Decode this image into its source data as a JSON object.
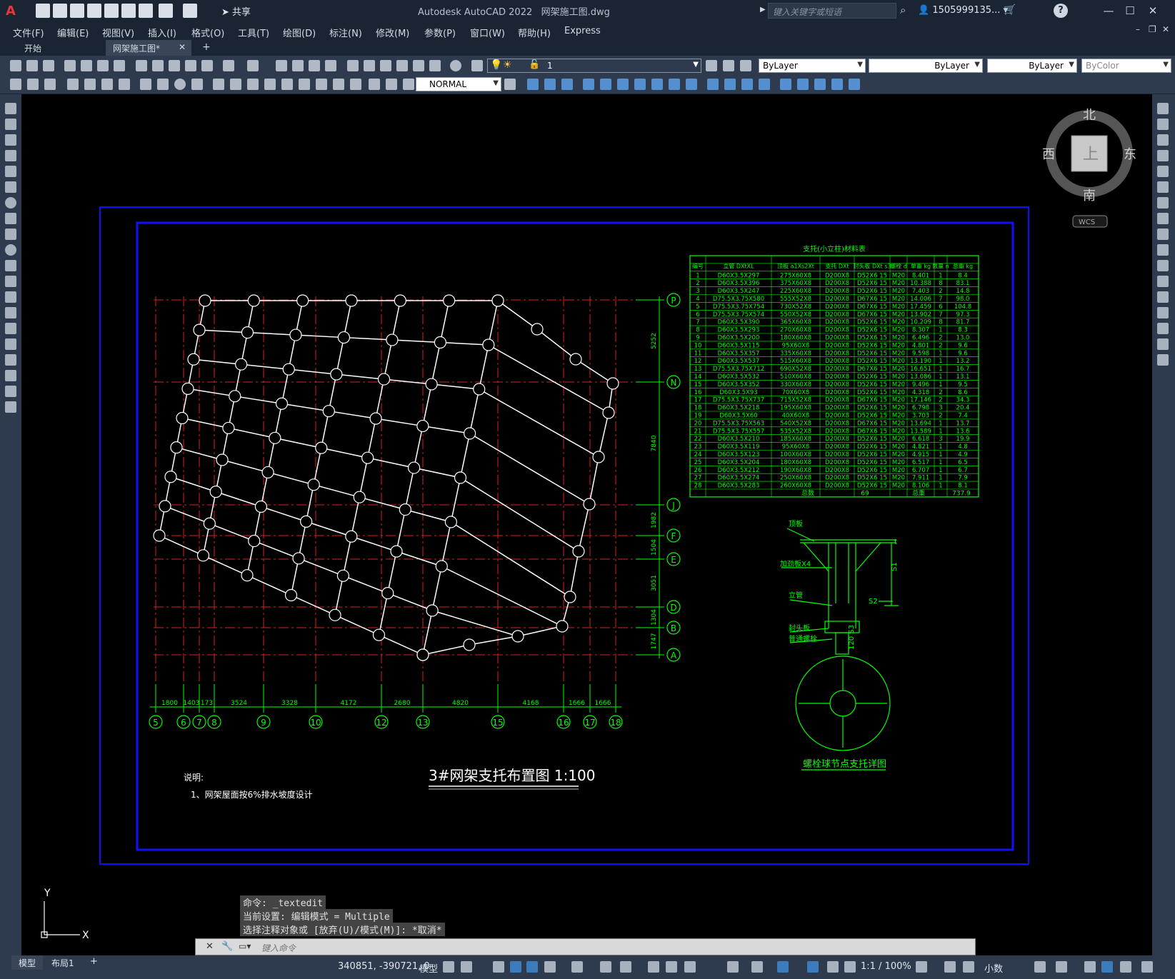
{
  "app": {
    "title": "Autodesk AutoCAD 2022",
    "document": "网架施工图.dwg",
    "share_label": "共享",
    "search_placeholder": "键入关键字或短语",
    "user": "1505999135..."
  },
  "menus": [
    "文件(F)",
    "编辑(E)",
    "视图(V)",
    "插入(I)",
    "格式(O)",
    "工具(T)",
    "绘图(D)",
    "标注(N)",
    "修改(M)",
    "参数(P)",
    "窗口(W)",
    "帮助(H)",
    "Express"
  ],
  "tabs": {
    "start": "开始",
    "current": "网架施工图*"
  },
  "properties": {
    "layer": "1",
    "color": "ByLayer",
    "linetype": "ByLayer",
    "lineweight": "ByLayer",
    "plotstyle": "ByColor",
    "textstyle": "NORMAL"
  },
  "viewcube": {
    "north": "北",
    "south": "南",
    "east": "东",
    "west": "西",
    "top": "上",
    "wcs": "WCS"
  },
  "drawing": {
    "title": "3#网架支托布置图 1:100",
    "note_heading": "说明:",
    "note_line": "1、网架屋面按6%排水坡度设计",
    "detail_title": "螺栓球节点支托详图",
    "table_title": "支托(小立柱)材料表",
    "table_headers": [
      "编号",
      "立管 DXtXL",
      "顶板 a1Xs2Xt",
      "支托 DXt",
      "封头板 DXt s3",
      "螺栓 d",
      "单重 kg",
      "数量 n",
      "总重 kg"
    ],
    "table_rows": [
      [
        "1",
        "D60X3.5X297",
        "275X60X8",
        "D200X8",
        "D52X6 15",
        "M20",
        "8.401",
        "1",
        "8.4"
      ],
      [
        "2",
        "D60X3.5X396",
        "375X60X8",
        "D200X8",
        "D52X6 15",
        "M20",
        "10.388",
        "8",
        "83.1"
      ],
      [
        "3",
        "D60X3.5X247",
        "225X60X8",
        "D200X8",
        "D52X6 15",
        "M20",
        "7.403",
        "2",
        "14.8"
      ],
      [
        "4",
        "D75.5X3.75X580",
        "555X52X8",
        "D200X8",
        "D67X6 15",
        "M20",
        "14.006",
        "7",
        "98.0"
      ],
      [
        "5",
        "D75.5X3.75X754",
        "730X52X8",
        "D200X8",
        "D67X6 15",
        "M20",
        "17.459",
        "6",
        "104.8"
      ],
      [
        "6",
        "D75.5X3.75X574",
        "550X52X8",
        "D200X8",
        "D67X6 15",
        "M20",
        "13.902",
        "7",
        "97.3"
      ],
      [
        "7",
        "D60X3.5X390",
        "365X60X8",
        "D200X8",
        "D52X6 15",
        "M20",
        "10.209",
        "8",
        "81.7"
      ],
      [
        "8",
        "D60X3.5X293",
        "270X60X8",
        "D200X8",
        "D52X6 15",
        "M20",
        "8.307",
        "1",
        "8.3"
      ],
      [
        "9",
        "D60X3.5X200",
        "180X60X8",
        "D200X8",
        "D52X6 15",
        "M20",
        "6.496",
        "2",
        "13.0"
      ],
      [
        "10",
        "D60X3.5X115",
        "95X60X8",
        "D200X8",
        "D52X6 15",
        "M20",
        "4.801",
        "2",
        "9.6"
      ],
      [
        "11",
        "D60X3.5X357",
        "335X60X8",
        "D200X8",
        "D52X6 15",
        "M20",
        "9.598",
        "1",
        "9.6"
      ],
      [
        "12",
        "D60X3.5X537",
        "515X60X8",
        "D200X8",
        "D52X6 15",
        "M20",
        "13.190",
        "1",
        "13.2"
      ],
      [
        "13",
        "D75.5X3.75X712",
        "690X52X8",
        "D200X8",
        "D67X6 15",
        "M20",
        "16.651",
        "1",
        "16.7"
      ],
      [
        "14",
        "D60X3.5X532",
        "510X60X8",
        "D200X8",
        "D52X6 15",
        "M20",
        "13.086",
        "1",
        "13.1"
      ],
      [
        "15",
        "D60X3.5X352",
        "330X60X8",
        "D200X8",
        "D52X6 15",
        "M20",
        "9.496",
        "1",
        "9.5"
      ],
      [
        "16",
        "D60X3.5X93",
        "70X60X8",
        "D200X8",
        "D52X6 15",
        "M20",
        "4.318",
        "2",
        "8.6"
      ],
      [
        "17",
        "D75.5X3.75X737",
        "715X52X8",
        "D200X8",
        "D67X6 15",
        "M20",
        "17.146",
        "2",
        "34.3"
      ],
      [
        "18",
        "D60X3.5X218",
        "195X60X8",
        "D200X8",
        "D52X6 15",
        "M20",
        "6.798",
        "3",
        "20.4"
      ],
      [
        "19",
        "D60X3.5X60",
        "40X60X8",
        "D200X8",
        "D52X6 15",
        "M20",
        "3.703",
        "2",
        "7.4"
      ],
      [
        "20",
        "D75.5X3.75X563",
        "540X52X8",
        "D200X8",
        "D67X6 15",
        "M20",
        "13.694",
        "1",
        "13.7"
      ],
      [
        "21",
        "D75.5X3.75X557",
        "535X52X8",
        "D200X8",
        "D67X6 15",
        "M20",
        "13.589",
        "1",
        "13.6"
      ],
      [
        "22",
        "D60X3.5X210",
        "185X60X8",
        "D200X8",
        "D52X6 15",
        "M20",
        "6.618",
        "3",
        "19.9"
      ],
      [
        "23",
        "D60X3.5X119",
        "95X60X8",
        "D200X8",
        "D52X6 15",
        "M20",
        "4.821",
        "1",
        "4.8"
      ],
      [
        "24",
        "D60X3.5X123",
        "100X60X8",
        "D200X8",
        "D52X6 15",
        "M20",
        "4.915",
        "1",
        "4.9"
      ],
      [
        "25",
        "D60X3.5X204",
        "180X60X8",
        "D200X8",
        "D52X6 15",
        "M20",
        "6.517",
        "1",
        "6.5"
      ],
      [
        "26",
        "D60X3.5X212",
        "190X60X8",
        "D200X8",
        "D52X6 15",
        "M20",
        "6.707",
        "1",
        "6.7"
      ],
      [
        "27",
        "D60X3.5X274",
        "250X60X8",
        "D200X8",
        "D52X6 15",
        "M20",
        "7.911",
        "1",
        "7.9"
      ],
      [
        "28",
        "D60X3.5X283",
        "260X60X8",
        "D200X8",
        "D52X6 15",
        "M20",
        "8.106",
        "1",
        "8.1"
      ]
    ],
    "table_total": {
      "count_label": "总数",
      "count": "69",
      "weight_label": "总重",
      "weight": "737.9"
    },
    "detail_labels": [
      "顶板",
      "加劲板X4",
      "立管",
      "封头板",
      "普通螺栓",
      "S1",
      "S2",
      "t",
      "120 S3"
    ],
    "col_axes": [
      "5",
      "6",
      "7",
      "8",
      "9",
      "10",
      "12",
      "13",
      "15",
      "16",
      "17",
      "18"
    ],
    "col_dims": [
      "1800",
      "1403",
      "173",
      "3524",
      "3328",
      "4172",
      "2680",
      "4820",
      "4168",
      "1666",
      "1666"
    ],
    "row_axes": [
      "P",
      "N",
      "J",
      "F",
      "E",
      "D",
      "B",
      "A"
    ],
    "row_dims": [
      "5252",
      "7840",
      "1982",
      "1504",
      "3051",
      "1304",
      "1747"
    ]
  },
  "command": {
    "line1": "命令: _textedit",
    "line2": "当前设置: 编辑模式 = Multiple",
    "line3": "选择注释对象或 [放弃(U)/模式(M)]: *取消*",
    "placeholder": "键入命令"
  },
  "status": {
    "model_tab": "模型",
    "layout_tab": "布局1",
    "coords": "340851, -390721, 0",
    "space": "模型",
    "scale": "1:1 / 100%",
    "units": "小数"
  }
}
